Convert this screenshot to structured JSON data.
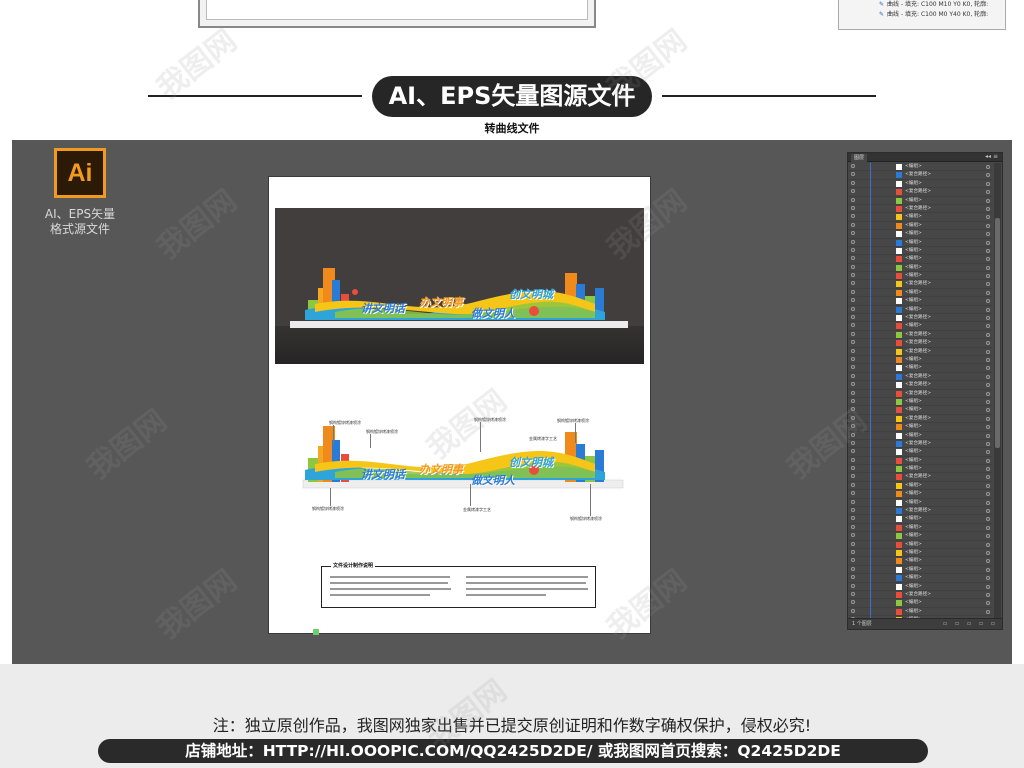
{
  "header": {
    "title": "AI、EPS矢量图源文件",
    "subtitle": "转曲线文件"
  },
  "top_right_panel": {
    "lines": [
      "曲线 - 填充: C100 M10 Y0 K0, 轮廓:",
      "曲线 - 填充: C100 M0 Y40 K0, 轮廓:"
    ]
  },
  "ai_badge": {
    "logo": "Ai",
    "label_line1": "AI、EPS矢量",
    "label_line2": "格式源文件",
    "accent_color": "#f29a1d"
  },
  "artboard": {
    "render_slogans": [
      "讲文明话",
      "办文明事",
      "创文明城",
      "做文明人"
    ],
    "plan_slogans": [
      "讲文明话",
      "办文明事",
      "创文明城",
      "做文明人"
    ],
    "plan_annotations": [
      "钢构镀锌烤漆喷涂",
      "钢构镀锌烤漆喷涂",
      "钢构镀锌烤漆喷涂",
      "钢构镀锌烤漆喷涂",
      "金属烤漆字工艺",
      "钢构镀锌烤漆喷涂",
      "金属烤漆字工艺",
      "钢构镀锌烤漆喷涂"
    ],
    "note_title": "文件设计制作说明"
  },
  "layers_panel": {
    "tab": "图层",
    "controls": "◂◂ ≡",
    "footer_label": "1 个图层",
    "footer_icons": "▫ ▫ ▫ ▫ ▫",
    "row_names": [
      "<编组>",
      "<复合路径>",
      "<编组>",
      "<复合路径>",
      "<编组>",
      "<复合路径>",
      "<编组>",
      "<编组>",
      "<编组>",
      "<编组>",
      "<编组>",
      "<编组>",
      "<编组>",
      "<编组>",
      "<复合路径>",
      "<编组>",
      "<编组>",
      "<编组>",
      "<复合路径>",
      "<编组>",
      "<复合路径>",
      "<复合路径>",
      "<复合路径>",
      "<编组>",
      "<编组>",
      "<复合路径>",
      "<复合路径>",
      "<复合路径>",
      "<编组>",
      "<编组>",
      "<复合路径>",
      "<编组>",
      "<编组>",
      "<复合路径>",
      "<编组>",
      "<编组>",
      "<编组>",
      "<复合路径>",
      "<编组>",
      "<编组>",
      "<编组>",
      "<复合路径>",
      "<编组>",
      "<编组>",
      "<编组>",
      "<编组>",
      "<编组>",
      "<编组>",
      "<编组>",
      "<编组>",
      "<编组>",
      "<复合路径>",
      "<编组>",
      "<编组>",
      "<编组>",
      "<编组>",
      "<编组>",
      "<编组>",
      "<编组>",
      "<复合路径>",
      "<编组>",
      "<复合路径>",
      "<复合路径>",
      "<编组>",
      "<复合路径>",
      "<复合路径>",
      "<编组>",
      "<编组>",
      "<编组>",
      "<编组>",
      "<编组>",
      "<编组>",
      "<编组>",
      "<编组>"
    ]
  },
  "footer": {
    "notice": "注：独立原创作品，我图网独家出售并已提交原创证明和作数字确权保护，侵权必究!",
    "shop": "店铺地址：HTTP://HI.OOOPIC.COM/QQ2425D2DE/ 或我图网首页搜索：Q2425D2DE"
  },
  "watermark": "我图网"
}
